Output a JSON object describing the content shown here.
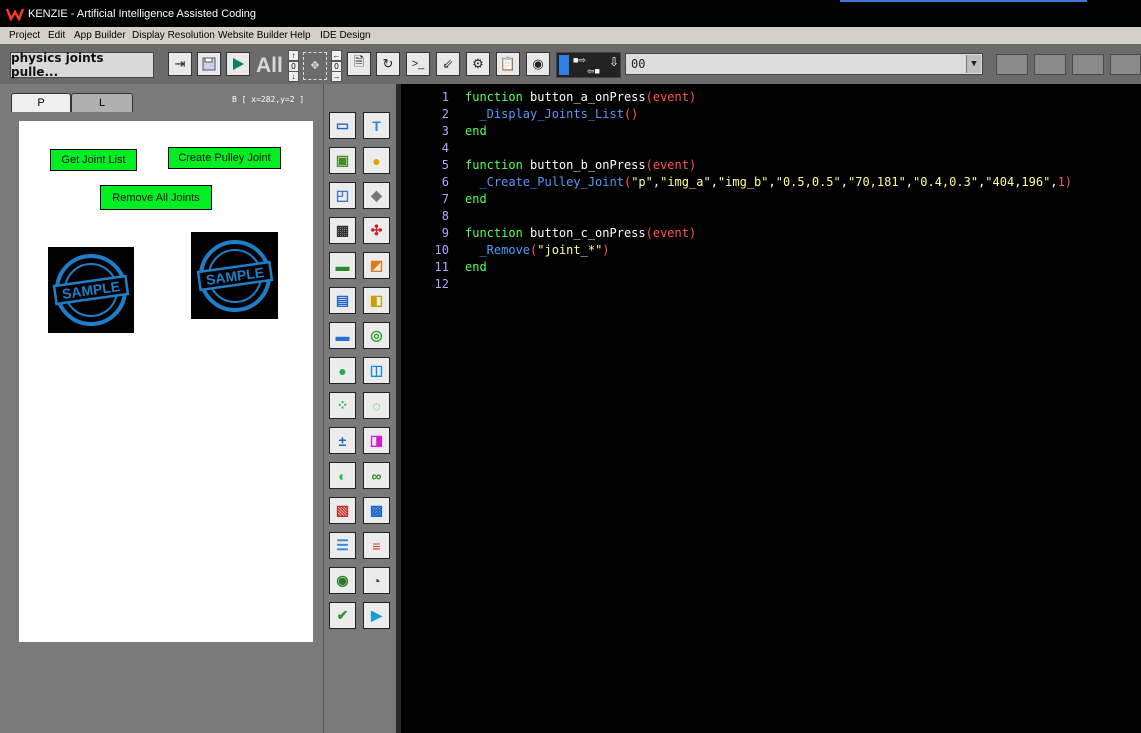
{
  "window": {
    "title": "KENZIE - Artificial Intelligence Assisted Coding"
  },
  "menu": [
    "Project",
    "Edit",
    "App Builder",
    "Display Resolution",
    "Website Builder",
    "Help",
    "IDE Design"
  ],
  "toolbar": {
    "project_button": "physics joints pulle...",
    "all_label": "All",
    "dropdown_value": "00"
  },
  "left_panel": {
    "tabs": [
      "P",
      "L"
    ],
    "coords": "B [ x=282,y=2 ]",
    "buttons": {
      "get_joints": "Get Joint List",
      "create_pulley": "Create Pulley Joint",
      "remove_all": "Remove All Joints"
    },
    "stamp_text": {
      "top": "SAMPLE",
      "middle": "SAMPLE",
      "bottom": "SAMPLE"
    }
  },
  "palette_icons": [
    "textbox-icon",
    "text-icon",
    "image-icon",
    "round-button-icon",
    "image-slider-icon",
    "shape-icon",
    "grid-icon",
    "joint-icon",
    "progress-icon",
    "shape-drag-icon",
    "textarea-icon",
    "shape-attach-icon",
    "slider-bar-icon",
    "node-icon",
    "toggle-slider-icon",
    "flowchart-icon",
    "spinner-icon",
    "connector-icon",
    "stepper-icon",
    "pink-node-icon",
    "switch-icon",
    "chain-icon",
    "html-icon",
    "web-icon",
    "menu-icon",
    "list-icon",
    "radio-icon",
    "timer-icon",
    "checkbox-icon",
    "clapper-icon"
  ],
  "editor": {
    "line_numbers": [
      "1",
      "2",
      "3",
      "4",
      "5",
      "6",
      "7",
      "8",
      "9",
      "10",
      "11",
      "12"
    ],
    "lines": [
      {
        "kw": "function",
        "name": "button_a_onPress",
        "lp": "(",
        "arg": "event",
        "rp": ")"
      },
      {
        "call": "_Display_Joints_List",
        "args": "()"
      },
      {
        "kw": "end"
      },
      {},
      {
        "kw": "function",
        "name": "button_b_onPress",
        "lp": "(",
        "arg": "event",
        "rp": ")"
      },
      {
        "call": "_Create_Pulley_Joint",
        "open": "(",
        "s1": "\"p\"",
        "c1": ",",
        "s2": "\"img_a\"",
        "c2": ",",
        "s3": "\"img_b\"",
        "c3": ",",
        "s4": "\"0.5,0.5\"",
        "c4": ",",
        "s5": "\"70,181\"",
        "c5": ",",
        "s6": "\"0.4,0.3\"",
        "c6": ",",
        "s7": "\"404,196\"",
        "c7": ",",
        "n1": "1",
        "close": ")"
      },
      {
        "kw": "end"
      },
      {},
      {
        "kw": "function",
        "name": "button_c_onPress",
        "lp": "(",
        "arg": "event",
        "rp": ")"
      },
      {
        "call": "_Remove",
        "open": "(",
        "s1": "\"joint_*\"",
        "close": ")"
      },
      {
        "kw": "end"
      },
      {}
    ]
  },
  "colors": {
    "keyword": "#55ff55",
    "param": "#ff5555",
    "call": "#5599ff",
    "string": "#ffff88",
    "button_green": "#00ee22"
  }
}
